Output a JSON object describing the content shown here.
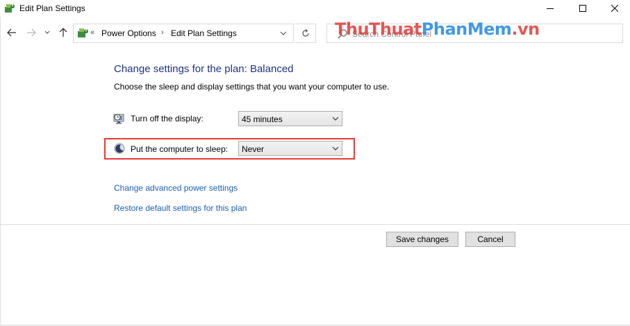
{
  "window": {
    "title": "Edit Plan Settings",
    "controls": {
      "minimize": "minimize",
      "maximize": "maximize",
      "close": "close"
    }
  },
  "nav": {
    "breadcrumb_prefix": "«",
    "crumbs": [
      "Power Options",
      "Edit Plan Settings"
    ],
    "separator": "›"
  },
  "search": {
    "placeholder": "Search Control Panel"
  },
  "watermark": {
    "part1": "ThuThuat",
    "part2": "PhanMem",
    "part3": ".vn"
  },
  "content": {
    "heading": "Change settings for the plan: Balanced",
    "subheading": "Choose the sleep and display settings that you want your computer to use.",
    "display": {
      "label": "Turn off the display:",
      "value": "45 minutes"
    },
    "sleep": {
      "label": "Put the computer to sleep:",
      "value": "Never"
    },
    "links": {
      "advanced": "Change advanced power settings",
      "restore": "Restore default settings for this plan"
    }
  },
  "buttons": {
    "save": "Save changes",
    "cancel": "Cancel"
  },
  "colors": {
    "heading": "#1e3287",
    "link": "#1a5fb4",
    "highlight": "#e53935"
  }
}
